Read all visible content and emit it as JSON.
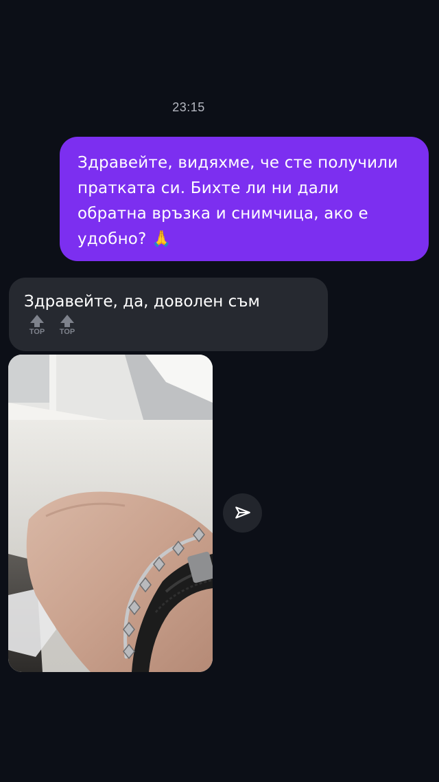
{
  "chat": {
    "timestamp": "23:15",
    "outgoing": {
      "text": "Здравейте, видяхме, че сте получили пратката си. Бихте ли ни дали обратна връзка и снимчица, ако е удобно?",
      "emoji": "🙏"
    },
    "incoming": {
      "text": "Здравейте, да, доволен съм",
      "badges": [
        "TOP",
        "TOP"
      ]
    },
    "photo": {
      "icon": "image"
    },
    "share_button": {
      "icon": "send-icon"
    }
  },
  "colors": {
    "background": "#0c0f17",
    "outgoing_bubble": "#7c2ff0",
    "incoming_bubble": "#262930",
    "timestamp": "#b6b9c2"
  }
}
